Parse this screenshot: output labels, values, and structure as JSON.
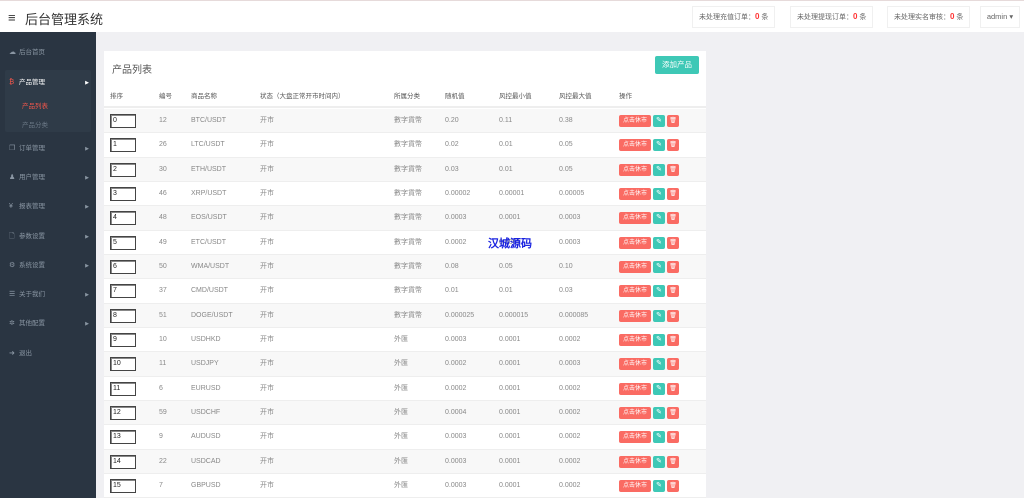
{
  "header": {
    "title": "后台管理系统",
    "stats": [
      {
        "label": "未处理充值订单：",
        "count": "0",
        "unit": "条"
      },
      {
        "label": "未处理提现订单：",
        "count": "0",
        "unit": "条"
      },
      {
        "label": "未处理实名审核：",
        "count": "0",
        "unit": "条"
      }
    ],
    "user": "admin"
  },
  "sidebar": {
    "items": [
      {
        "label": "后台首页",
        "icon": "dashboard-icon"
      },
      {
        "label": "产品管理",
        "icon": "bitcoin-icon"
      },
      {
        "label": "订单管理",
        "icon": "copy-icon"
      },
      {
        "label": "用户管理",
        "icon": "user-icon"
      },
      {
        "label": "报表管理",
        "icon": "yen-icon"
      },
      {
        "label": "参数设置",
        "icon": "file-icon"
      },
      {
        "label": "系统设置",
        "icon": "cogs-icon"
      },
      {
        "label": "关于我们",
        "icon": "list-icon"
      },
      {
        "label": "其他配置",
        "icon": "gear-icon"
      },
      {
        "label": "退出",
        "icon": "sign-out-icon"
      }
    ],
    "sub": [
      "产品列表",
      "产品分类"
    ]
  },
  "card": {
    "title": "产品列表",
    "add_label": "添加产品"
  },
  "table": {
    "headers": [
      "排序",
      "编号",
      "商品名称",
      "状态（大盘正常开市时间内）",
      "所属分类",
      "随机值",
      "风控最小值",
      "风控最大值",
      "操作"
    ],
    "actions": {
      "close": "点击休市"
    },
    "rows": [
      [
        "0",
        "12",
        "BTC/USDT",
        "开市",
        "數字貨幣",
        "0.20",
        "0.11",
        "0.38"
      ],
      [
        "1",
        "26",
        "LTC/USDT",
        "开市",
        "數字貨幣",
        "0.02",
        "0.01",
        "0.05"
      ],
      [
        "2",
        "30",
        "ETH/USDT",
        "开市",
        "數字貨幣",
        "0.03",
        "0.01",
        "0.05"
      ],
      [
        "3",
        "46",
        "XRP/USDT",
        "开市",
        "數字貨幣",
        "0.00002",
        "0.00001",
        "0.00005"
      ],
      [
        "4",
        "48",
        "EOS/USDT",
        "开市",
        "數字貨幣",
        "0.0003",
        "0.0001",
        "0.0003"
      ],
      [
        "5",
        "49",
        "ETC/USDT",
        "开市",
        "數字貨幣",
        "0.0002",
        "0.0001",
        "0.0003"
      ],
      [
        "6",
        "50",
        "WMA/USDT",
        "开市",
        "數字貨幣",
        "0.08",
        "0.05",
        "0.10"
      ],
      [
        "7",
        "37",
        "CMD/USDT",
        "开市",
        "數字貨幣",
        "0.01",
        "0.01",
        "0.03"
      ],
      [
        "8",
        "51",
        "DOGE/USDT",
        "开市",
        "數字貨幣",
        "0.000025",
        "0.000015",
        "0.000085"
      ],
      [
        "9",
        "10",
        "USDHKD",
        "开市",
        "外匯",
        "0.0003",
        "0.0001",
        "0.0002"
      ],
      [
        "10",
        "11",
        "USDJPY",
        "开市",
        "外匯",
        "0.0002",
        "0.0001",
        "0.0003"
      ],
      [
        "11",
        "6",
        "EURUSD",
        "开市",
        "外匯",
        "0.0002",
        "0.0001",
        "0.0002"
      ],
      [
        "12",
        "59",
        "USDCHF",
        "开市",
        "外匯",
        "0.0004",
        "0.0001",
        "0.0002"
      ],
      [
        "13",
        "9",
        "AUDUSD",
        "开市",
        "外匯",
        "0.0003",
        "0.0001",
        "0.0002"
      ],
      [
        "14",
        "22",
        "USDCAD",
        "开市",
        "外匯",
        "0.0003",
        "0.0001",
        "0.0002"
      ],
      [
        "15",
        "7",
        "GBPUSD",
        "开市",
        "外匯",
        "0.0003",
        "0.0001",
        "0.0002"
      ]
    ]
  },
  "watermark": "汉城源码"
}
